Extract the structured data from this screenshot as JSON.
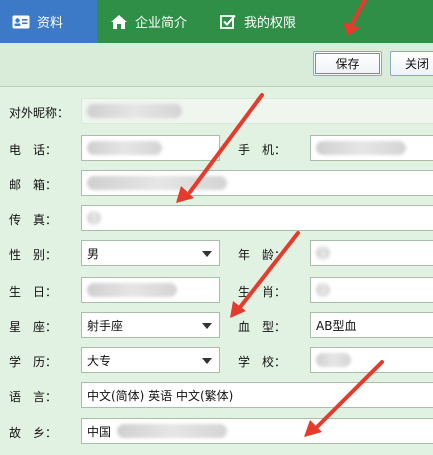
{
  "tabs": [
    {
      "label": "资料",
      "icon": "id-card-icon",
      "active": true
    },
    {
      "label": "企业简介",
      "icon": "home-icon",
      "active": false
    },
    {
      "label": "我的权限",
      "icon": "checkbox-icon",
      "active": false
    }
  ],
  "toolbar": {
    "save_label": "保存",
    "close_label": "关闭"
  },
  "form": {
    "nickname_label": "对外昵称：",
    "phone_label": "电　话：",
    "mobile_label": "手　机：",
    "email_label": "邮　箱：",
    "fax_label": "传　真：",
    "gender_label": "性　别：",
    "gender_value": "男",
    "age_label": "年　龄：",
    "birthday_label": "生　日：",
    "zodiac_animal_label": "生　肖：",
    "constellation_label": "星　座：",
    "constellation_value": "射手座",
    "blood_label": "血　型：",
    "blood_value": "AB型血",
    "education_label": "学　历：",
    "education_value": "大专",
    "school_label": "学　校：",
    "language_label": "语　言：",
    "language_value": "中文(简体) 英语 中文(繁体)",
    "hometown_label": "故　乡：",
    "hometown_value": "中国"
  },
  "colors": {
    "tabbar": "#2f8f47",
    "active_tab": "#3c79c7",
    "arrow": "#e53a2c",
    "form_bg": "#e2f2e2"
  }
}
